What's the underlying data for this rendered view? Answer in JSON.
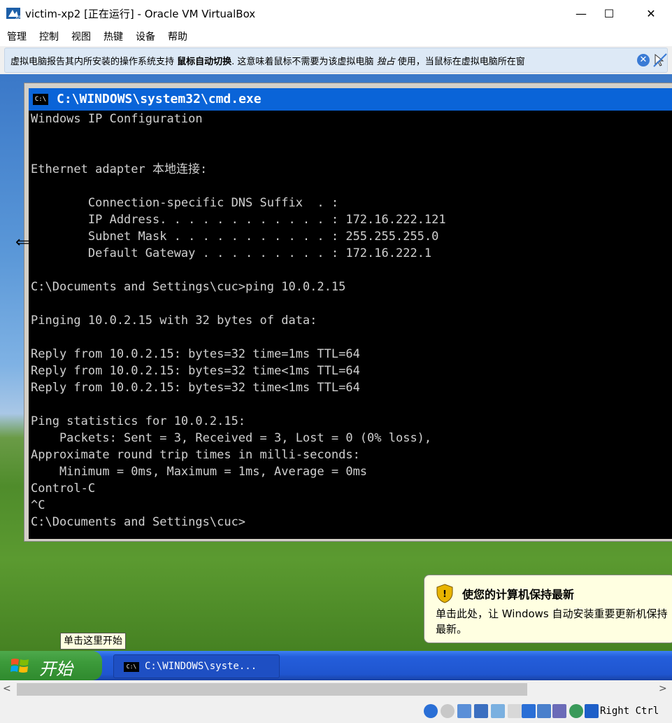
{
  "window": {
    "title": "victim-xp2 [正在运行] - Oracle VM VirtualBox",
    "minimize_glyph": "—",
    "maximize_glyph": "☐",
    "close_glyph": "✕"
  },
  "menu": [
    "管理",
    "控制",
    "视图",
    "热键",
    "设备",
    "帮助"
  ],
  "notice": {
    "part1": "虚拟电脑报告其内所安装的操作系统支持 ",
    "bold": "鼠标自动切换",
    "part2": ". 这意味着鼠标不需要为该虚拟电脑 ",
    "italic": "独占",
    "part3": " 使用，当鼠标在虚拟电脑所在窗"
  },
  "cmd": {
    "icon_text": "C:\\",
    "title": "C:\\WINDOWS\\system32\\cmd.exe",
    "lines": [
      "Windows IP Configuration",
      "",
      "",
      "Ethernet adapter 本地连接:",
      "",
      "        Connection-specific DNS Suffix  . :",
      "        IP Address. . . . . . . . . . . . : 172.16.222.121",
      "        Subnet Mask . . . . . . . . . . . : 255.255.255.0",
      "        Default Gateway . . . . . . . . . : 172.16.222.1",
      "",
      "C:\\Documents and Settings\\cuc>ping 10.0.2.15",
      "",
      "Pinging 10.0.2.15 with 32 bytes of data:",
      "",
      "Reply from 10.0.2.15: bytes=32 time=1ms TTL=64",
      "Reply from 10.0.2.15: bytes=32 time<1ms TTL=64",
      "Reply from 10.0.2.15: bytes=32 time<1ms TTL=64",
      "",
      "Ping statistics for 10.0.2.15:",
      "    Packets: Sent = 3, Received = 3, Lost = 0 (0% loss),",
      "Approximate round trip times in milli-seconds:",
      "    Minimum = 0ms, Maximum = 1ms, Average = 0ms",
      "Control-C",
      "^C",
      "C:\\Documents and Settings\\cuc>"
    ]
  },
  "balloon": {
    "title": "使您的计算机保持最新",
    "body": "单击此处，让 Windows 自动安装重要更新机保持最新。"
  },
  "start_tooltip": "单击这里开始",
  "start_label": "开始",
  "task_item": {
    "icon_text": "C:\\",
    "label": "C:\\WINDOWS\\syste..."
  },
  "scroll": {
    "left": "<",
    "right": ">"
  },
  "host_key": "Right Ctrl",
  "colors": {
    "cmd_title_bg": "#0a64d8",
    "console_bg": "#000000",
    "console_fg": "#d0d0d0",
    "taskbar": "#245edb",
    "start_button": "#3c9a3a",
    "balloon_bg": "#ffffe1"
  }
}
